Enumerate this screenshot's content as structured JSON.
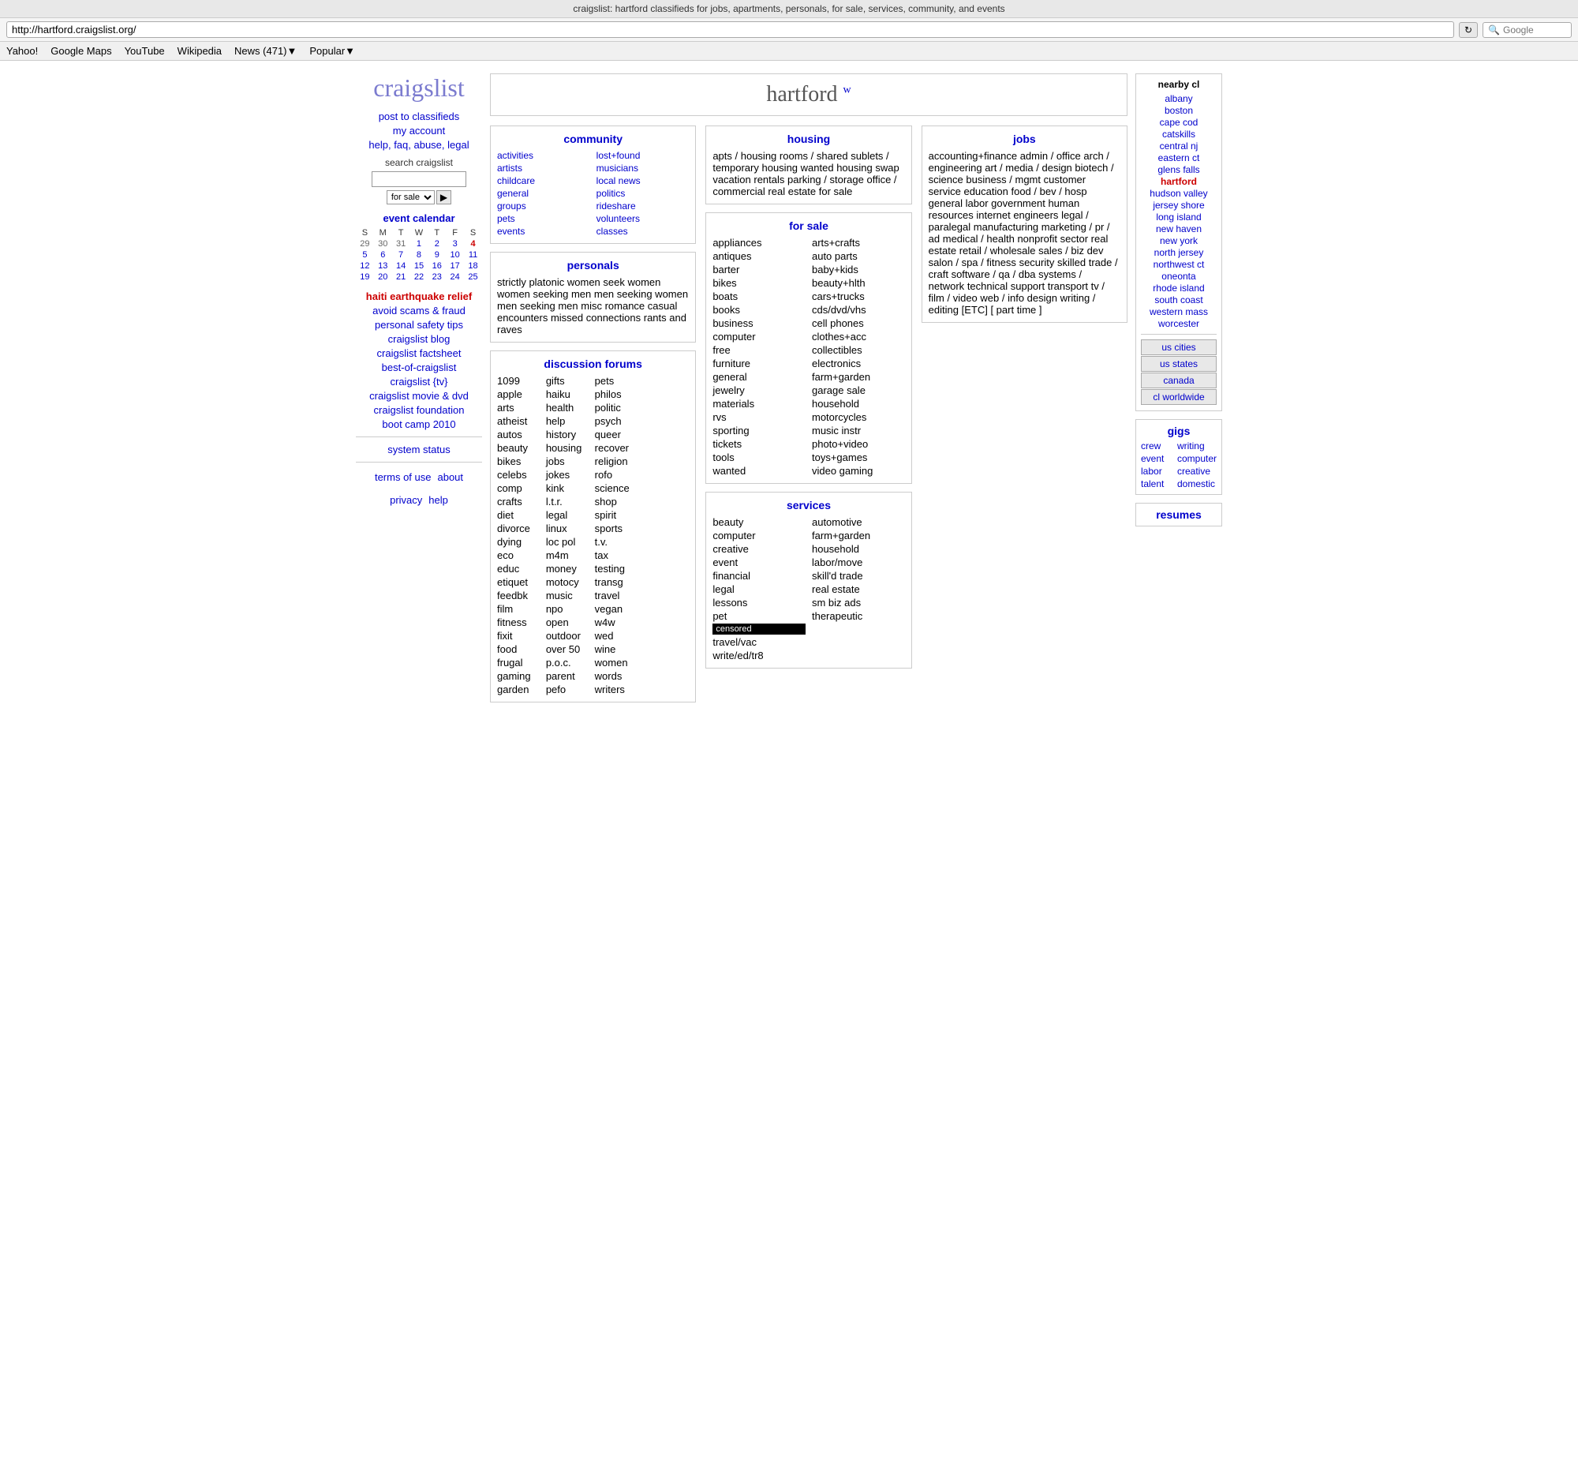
{
  "browser": {
    "title": "craigslist: hartford classifieds for jobs, apartments, personals, for sale, services, community, and events",
    "url": "http://hartford.craigslist.org/",
    "refresh_label": "↻",
    "search_placeholder": "Google",
    "nav_items": [
      "Yahoo!",
      "Google Maps",
      "YouTube",
      "Wikipedia",
      "News (471)▼",
      "Popular▼"
    ]
  },
  "sidebar": {
    "logo": "craigslist",
    "links": [
      "post to classifieds",
      "my account",
      "help, faq, abuse, legal"
    ],
    "search_label": "search craigslist",
    "search_placeholder": "",
    "search_option": "for sale",
    "search_go": "▶",
    "calendar_title": "event calendar",
    "calendar_days_header": [
      "S",
      "M",
      "T",
      "W",
      "T",
      "F",
      "S"
    ],
    "calendar_weeks": [
      [
        "29",
        "30",
        "31",
        "1",
        "2",
        "3",
        "4"
      ],
      [
        "5",
        "6",
        "7",
        "8",
        "9",
        "10",
        "11"
      ],
      [
        "12",
        "13",
        "14",
        "15",
        "16",
        "17",
        "18"
      ],
      [
        "19",
        "20",
        "21",
        "22",
        "23",
        "24",
        "25"
      ]
    ],
    "today": "4",
    "red_link": "haiti earthquake relief",
    "extra_links": [
      "avoid scams & fraud",
      "personal safety tips",
      "craigslist blog",
      "craigslist factsheet",
      "best-of-craigslist",
      "craigslist {tv}",
      "craigslist movie & dvd",
      "craigslist foundation",
      "boot camp 2010"
    ],
    "status_link": "system status",
    "footer_links": [
      "terms of use",
      "about",
      "privacy",
      "help"
    ]
  },
  "hartford": {
    "city": "hartford",
    "w": "w"
  },
  "community": {
    "title": "community",
    "col1": [
      "activities",
      "artists",
      "childcare",
      "general",
      "groups",
      "pets",
      "events"
    ],
    "col2": [
      "lost+found",
      "musicians",
      "local news",
      "politics",
      "rideshare",
      "volunteers",
      "classes"
    ]
  },
  "personals": {
    "title": "personals",
    "links": [
      "strictly platonic",
      "women seek women",
      "women seeking men",
      "men seeking women",
      "men seeking men",
      "misc romance",
      "casual encounters",
      "missed connections",
      "rants and raves"
    ]
  },
  "discussion_forums": {
    "title": "discussion forums",
    "links": [
      "1099",
      "apple",
      "arts",
      "atheist",
      "autos",
      "beauty",
      "bikes",
      "celebs",
      "comp",
      "crafts",
      "diet",
      "divorce",
      "dying",
      "eco",
      "educ",
      "etiquet",
      "feedbk",
      "film",
      "fitness",
      "fixit",
      "food",
      "frugal",
      "gaming",
      "garden",
      "gifts",
      "haiku",
      "health",
      "help",
      "history",
      "housing",
      "jobs",
      "jokes",
      "kink",
      "l.t.r.",
      "legal",
      "linux",
      "loc pol",
      "m4m",
      "money",
      "motocy",
      "music",
      "npo",
      "open",
      "outdoor",
      "over 50",
      "p.o.c.",
      "parent",
      "pefo",
      "pets",
      "philos",
      "politic",
      "psych",
      "queer",
      "recover",
      "religion",
      "rofo",
      "science",
      "shop",
      "spirit",
      "sports",
      "t.v.",
      "tax",
      "testing",
      "transg",
      "travel",
      "vegan",
      "w4w",
      "wed",
      "wine",
      "women",
      "words",
      "writers"
    ]
  },
  "housing": {
    "title": "housing",
    "links": [
      "apts / housing",
      "rooms / shared",
      "sublets / temporary",
      "housing wanted",
      "housing swap",
      "vacation rentals",
      "parking / storage",
      "office / commercial",
      "real estate for sale"
    ]
  },
  "for_sale": {
    "title": "for sale",
    "col1": [
      "appliances",
      "antiques",
      "barter",
      "bikes",
      "boats",
      "books",
      "business",
      "computer",
      "free",
      "furniture",
      "general",
      "jewelry",
      "materials",
      "rvs",
      "sporting",
      "tickets",
      "tools",
      "wanted"
    ],
    "col2": [
      "arts+crafts",
      "auto parts",
      "baby+kids",
      "beauty+hlth",
      "cars+trucks",
      "cds/dvd/vhs",
      "cell phones",
      "clothes+acc",
      "collectibles",
      "electronics",
      "farm+garden",
      "garage sale",
      "household",
      "motorcycles",
      "music instr",
      "photo+video",
      "toys+games",
      "video gaming"
    ]
  },
  "services": {
    "title": "services",
    "col1": [
      "beauty",
      "computer",
      "creative",
      "event",
      "financial",
      "legal",
      "lessons",
      "pet",
      "censored",
      "travel/vac",
      "write/ed/tr8"
    ],
    "col2": [
      "automotive",
      "farm+garden",
      "household",
      "labor/move",
      "skill'd trade",
      "real estate",
      "sm biz ads",
      "therapeutic"
    ]
  },
  "jobs": {
    "title": "jobs",
    "links": [
      "accounting+finance",
      "admin / office",
      "arch / engineering",
      "art / media / design",
      "biotech / science",
      "business / mgmt",
      "customer service",
      "education",
      "food / bev / hosp",
      "general labor",
      "government",
      "human resources",
      "internet engineers",
      "legal / paralegal",
      "manufacturing",
      "marketing / pr / ad",
      "medical / health",
      "nonprofit sector",
      "real estate",
      "retail / wholesale",
      "sales / biz dev",
      "salon / spa / fitness",
      "security",
      "skilled trade / craft",
      "software / qa / dba",
      "systems / network",
      "technical support",
      "transport",
      "tv / film / video",
      "web / info design",
      "writing / editing",
      "[ETC]",
      "[ part time ]"
    ]
  },
  "nearby": {
    "title": "nearby cl",
    "cities": [
      "albany",
      "boston",
      "cape cod",
      "catskills",
      "central nj",
      "eastern ct",
      "glens falls",
      "hartford",
      "hudson valley",
      "jersey shore",
      "long island",
      "new haven",
      "new york",
      "north jersey",
      "northwest ct",
      "oneonta",
      "rhode island",
      "south coast",
      "western mass",
      "worcester"
    ],
    "current_city": "hartford",
    "buttons": [
      "us cities",
      "us states",
      "canada",
      "cl worldwide"
    ]
  },
  "gigs": {
    "title": "gigs",
    "col1": [
      "crew",
      "event",
      "labor",
      "talent"
    ],
    "col2": [
      "writing",
      "computer",
      "creative",
      "domestic"
    ]
  },
  "resumes": {
    "title": "resumes"
  }
}
